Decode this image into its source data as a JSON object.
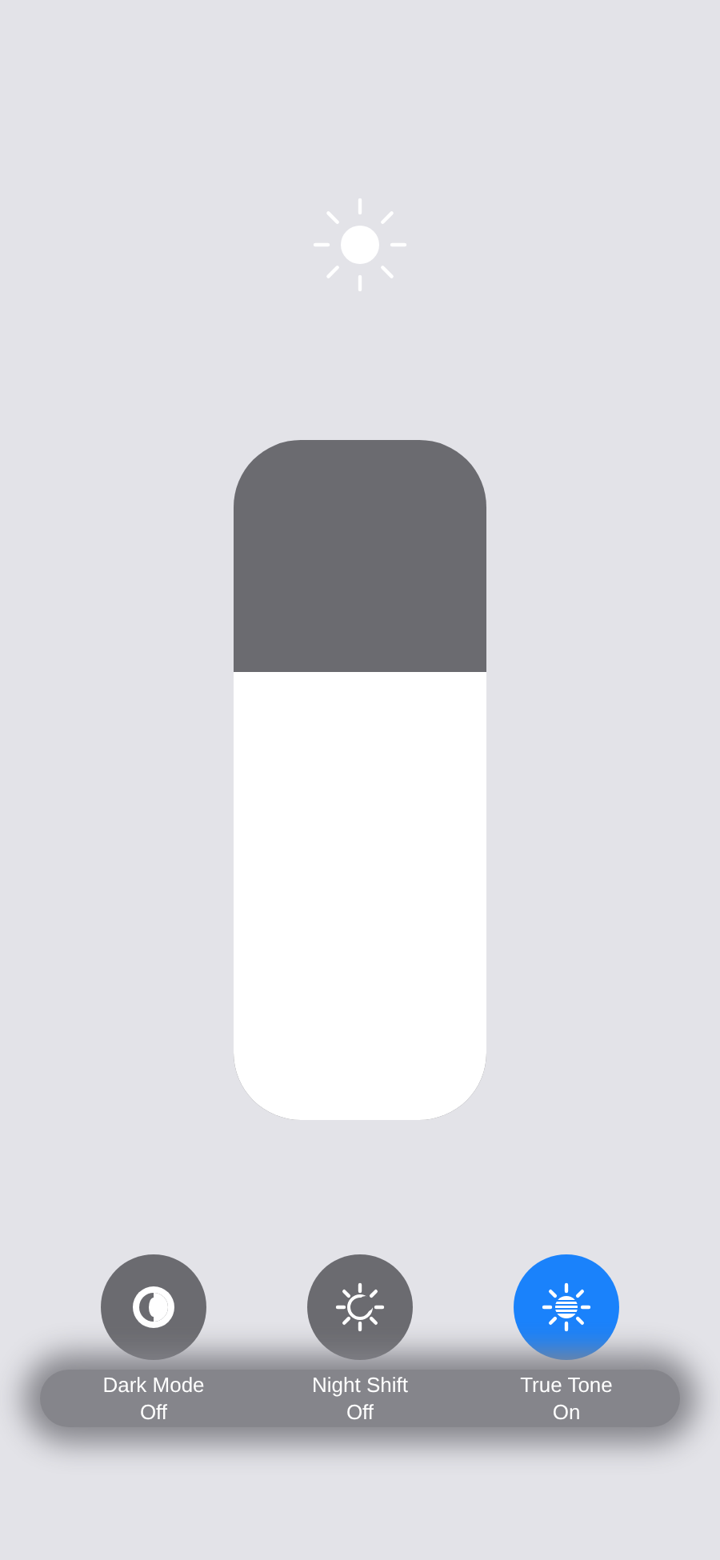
{
  "brightness": {
    "level": 0.66
  },
  "toggles": [
    {
      "kind": "dark-mode",
      "label": "Dark Mode",
      "status": "Off",
      "on": false
    },
    {
      "kind": "night-shift",
      "label": "Night Shift",
      "status": "Off",
      "on": false
    },
    {
      "kind": "true-tone",
      "label": "True Tone",
      "status": "On",
      "on": true
    }
  ]
}
